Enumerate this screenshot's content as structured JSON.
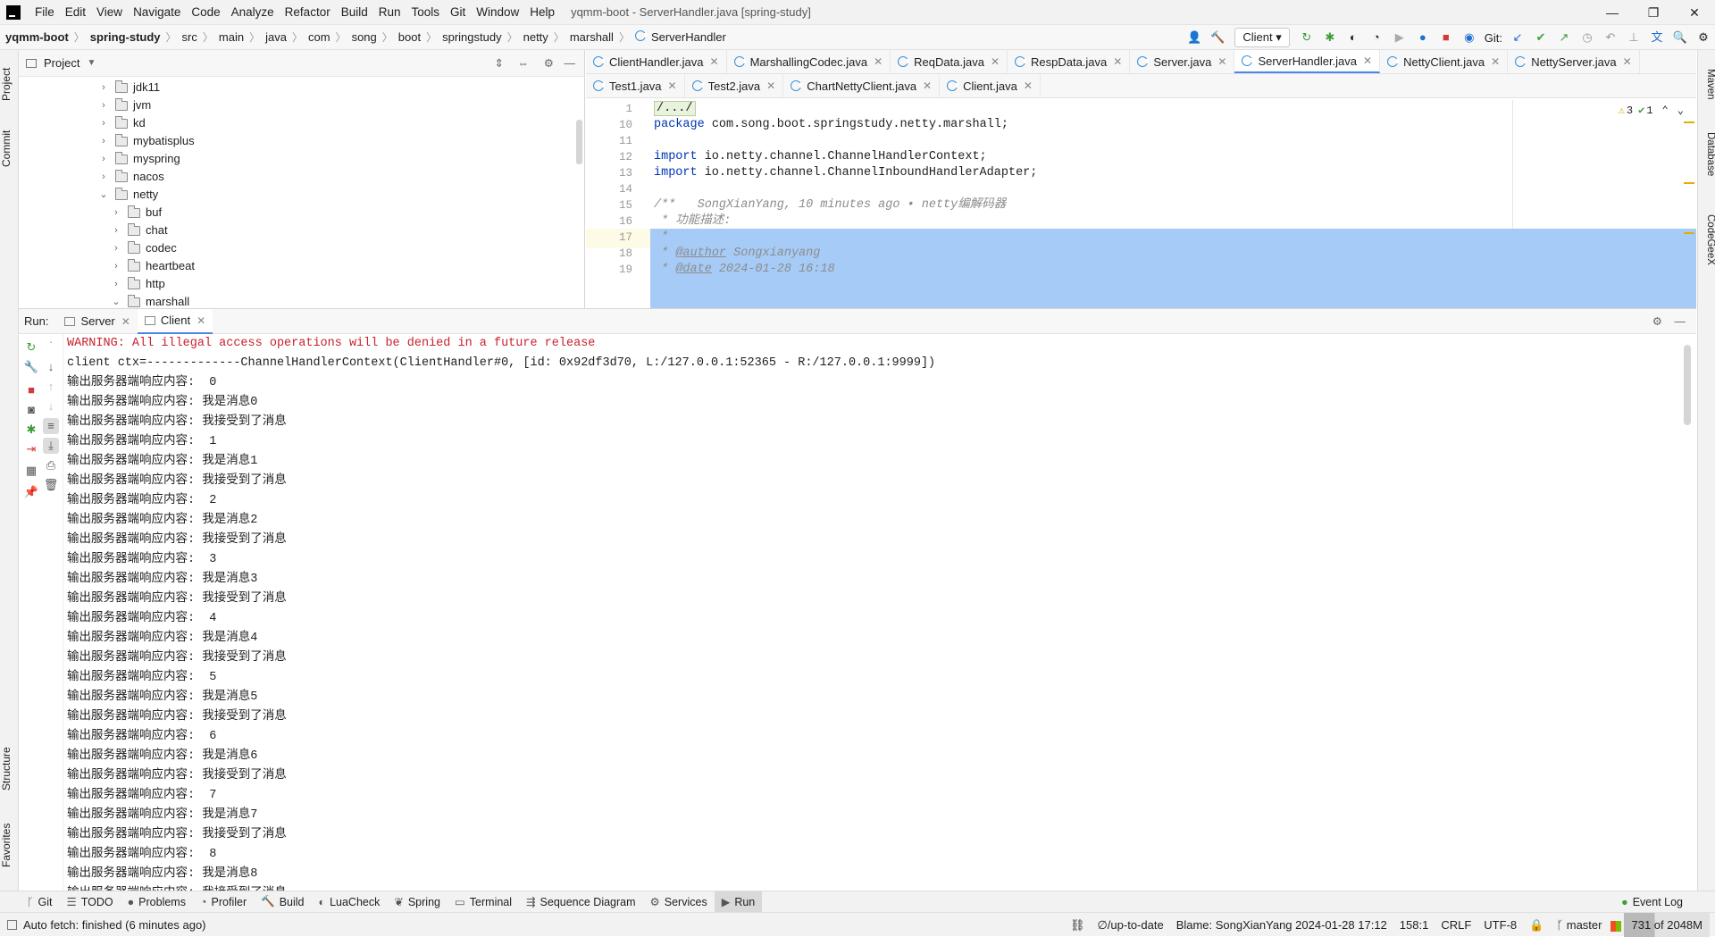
{
  "menu": {
    "items": [
      "File",
      "Edit",
      "View",
      "Navigate",
      "Code",
      "Analyze",
      "Refactor",
      "Build",
      "Run",
      "Tools",
      "Git",
      "Window",
      "Help"
    ],
    "window_title": "yqmm-boot - ServerHandler.java [spring-study]"
  },
  "nav": {
    "breadcrumbs": [
      "yqmm-boot",
      "spring-study",
      "src",
      "main",
      "java",
      "com",
      "song",
      "boot",
      "springstudy",
      "netty",
      "marshall",
      "ServerHandler"
    ],
    "run_config": "Client",
    "git_label": "Git:"
  },
  "project": {
    "title": "Project",
    "tree": [
      {
        "label": "jdk11",
        "depth": 0,
        "expanded": false
      },
      {
        "label": "jvm",
        "depth": 0,
        "expanded": false
      },
      {
        "label": "kd",
        "depth": 0,
        "expanded": false
      },
      {
        "label": "mybatisplus",
        "depth": 0,
        "expanded": false
      },
      {
        "label": "myspring",
        "depth": 0,
        "expanded": false
      },
      {
        "label": "nacos",
        "depth": 0,
        "expanded": false
      },
      {
        "label": "netty",
        "depth": 0,
        "expanded": true
      },
      {
        "label": "buf",
        "depth": 1,
        "expanded": false
      },
      {
        "label": "chat",
        "depth": 1,
        "expanded": false
      },
      {
        "label": "codec",
        "depth": 1,
        "expanded": false
      },
      {
        "label": "heartbeat",
        "depth": 1,
        "expanded": false
      },
      {
        "label": "http",
        "depth": 1,
        "expanded": false
      },
      {
        "label": "marshall",
        "depth": 1,
        "expanded": true
      }
    ]
  },
  "editor": {
    "tabs_row1": [
      {
        "label": "ClientHandler.java",
        "active": false
      },
      {
        "label": "MarshallingCodec.java",
        "active": false
      },
      {
        "label": "ReqData.java",
        "active": false
      },
      {
        "label": "RespData.java",
        "active": false
      },
      {
        "label": "Server.java",
        "active": false
      },
      {
        "label": "ServerHandler.java",
        "active": true
      },
      {
        "label": "NettyClient.java",
        "active": false
      },
      {
        "label": "NettyServer.java",
        "active": false
      }
    ],
    "tabs_row2": [
      {
        "label": "Test1.java"
      },
      {
        "label": "Test2.java"
      },
      {
        "label": "ChartNettyClient.java"
      },
      {
        "label": "Client.java"
      }
    ],
    "inspections": {
      "warnings": "3",
      "ok": "1"
    },
    "lines": [
      {
        "n": "1",
        "text": "/.../",
        "cls": "fold"
      },
      {
        "n": "10",
        "text": "package com.song.boot.springstudy.netty.marshall;",
        "cls": "pkg"
      },
      {
        "n": "11",
        "text": "",
        "cls": ""
      },
      {
        "n": "12",
        "text": "import io.netty.channel.ChannelHandlerContext;",
        "cls": "imp"
      },
      {
        "n": "13",
        "text": "import io.netty.channel.ChannelInboundHandlerAdapter;",
        "cls": "imp"
      },
      {
        "n": "14",
        "text": "",
        "cls": ""
      },
      {
        "n": "15",
        "text": "/**   SongXianYang, 10 minutes ago • netty编解码器",
        "cls": "doc"
      },
      {
        "n": "16",
        "text": " * 功能描述:",
        "cls": "doc"
      },
      {
        "n": "17",
        "text": " *",
        "cls": "doc"
      },
      {
        "n": "18",
        "text": " * @author Songxianyang",
        "cls": "doc"
      },
      {
        "n": "19",
        "text": " * @date 2024-01-28 16:18",
        "cls": "doc"
      }
    ]
  },
  "run": {
    "label": "Run:",
    "tabs": [
      {
        "label": "Server",
        "active": false
      },
      {
        "label": "Client",
        "active": true
      }
    ],
    "console": [
      {
        "text": "WARNING: All illegal access operations will be denied in a future release",
        "warn": true
      },
      {
        "text": "client ctx=-------------ChannelHandlerContext(ClientHandler#0, [id: 0x92df3d70, L:/127.0.0.1:52365 - R:/127.0.0.1:9999])",
        "warn": false
      },
      {
        "text": "输出服务器端响应内容:  0",
        "warn": false
      },
      {
        "text": "输出服务器端响应内容: 我是消息0",
        "warn": false
      },
      {
        "text": "输出服务器端响应内容: 我接受到了消息",
        "warn": false
      },
      {
        "text": "输出服务器端响应内容:  1",
        "warn": false
      },
      {
        "text": "输出服务器端响应内容: 我是消息1",
        "warn": false
      },
      {
        "text": "输出服务器端响应内容: 我接受到了消息",
        "warn": false
      },
      {
        "text": "输出服务器端响应内容:  2",
        "warn": false
      },
      {
        "text": "输出服务器端响应内容: 我是消息2",
        "warn": false
      },
      {
        "text": "输出服务器端响应内容: 我接受到了消息",
        "warn": false
      },
      {
        "text": "输出服务器端响应内容:  3",
        "warn": false
      },
      {
        "text": "输出服务器端响应内容: 我是消息3",
        "warn": false
      },
      {
        "text": "输出服务器端响应内容: 我接受到了消息",
        "warn": false
      },
      {
        "text": "输出服务器端响应内容:  4",
        "warn": false
      },
      {
        "text": "输出服务器端响应内容: 我是消息4",
        "warn": false
      },
      {
        "text": "输出服务器端响应内容: 我接受到了消息",
        "warn": false
      },
      {
        "text": "输出服务器端响应内容:  5",
        "warn": false
      },
      {
        "text": "输出服务器端响应内容: 我是消息5",
        "warn": false
      },
      {
        "text": "输出服务器端响应内容: 我接受到了消息",
        "warn": false
      },
      {
        "text": "输出服务器端响应内容:  6",
        "warn": false
      },
      {
        "text": "输出服务器端响应内容: 我是消息6",
        "warn": false
      },
      {
        "text": "输出服务器端响应内容: 我接受到了消息",
        "warn": false
      },
      {
        "text": "输出服务器端响应内容:  7",
        "warn": false
      },
      {
        "text": "输出服务器端响应内容: 我是消息7",
        "warn": false
      },
      {
        "text": "输出服务器端响应内容: 我接受到了消息",
        "warn": false
      },
      {
        "text": "输出服务器端响应内容:  8",
        "warn": false
      },
      {
        "text": "输出服务器端响应内容: 我是消息8",
        "warn": false
      },
      {
        "text": "输出服务器端响应内容: 我接受到了消息",
        "warn": false
      }
    ]
  },
  "side_left": [
    "Project",
    "Commit",
    "Structure",
    "Favorites"
  ],
  "side_right": [
    "Maven",
    "Database",
    "CodeGeeX"
  ],
  "bottom_tools": [
    {
      "label": "Git",
      "icon": "git-icon"
    },
    {
      "label": "TODO",
      "icon": "list-icon"
    },
    {
      "label": "Problems",
      "icon": "problems-icon"
    },
    {
      "label": "Profiler",
      "icon": "profiler-icon"
    },
    {
      "label": "Build",
      "icon": "hammer-icon"
    },
    {
      "label": "LuaCheck",
      "icon": "luacheck-icon"
    },
    {
      "label": "Spring",
      "icon": "spring-icon"
    },
    {
      "label": "Terminal",
      "icon": "terminal-icon"
    },
    {
      "label": "Sequence Diagram",
      "icon": "sequence-icon"
    },
    {
      "label": "Services",
      "icon": "services-icon"
    },
    {
      "label": "Run",
      "icon": "run-icon",
      "active": true
    }
  ],
  "event_log": "Event Log",
  "status": {
    "message": "Auto fetch: finished (6 minutes ago)",
    "vcs": "∅/up-to-date",
    "blame": "Blame: SongXianYang 2024-01-28 17:12",
    "position": "158:1",
    "line_sep": "CRLF",
    "encoding": "UTF-8",
    "branch": "master",
    "memory": "731 of 2048M"
  },
  "colors": {
    "accent": "#4a86e8",
    "selection": "#a6cbf6",
    "warn": "#c7222d"
  }
}
